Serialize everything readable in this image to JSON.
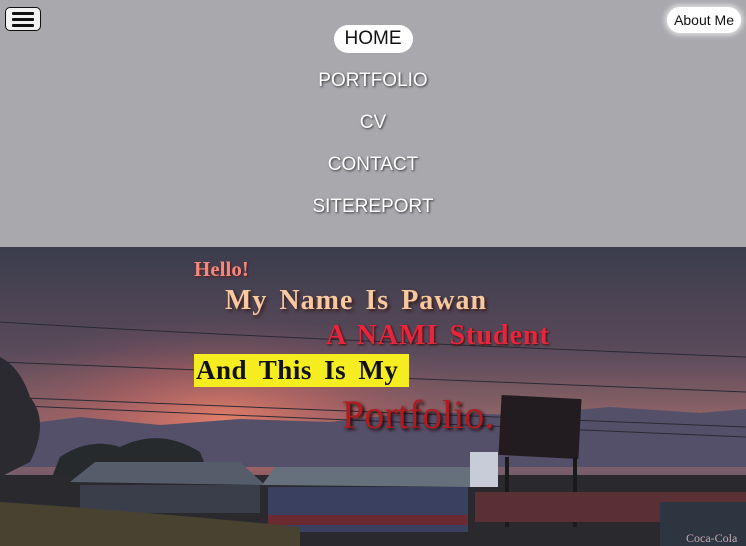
{
  "menu": {
    "icon": "hamburger-icon"
  },
  "about_button": "About Me",
  "nav": {
    "items": [
      {
        "label": "HOME",
        "active": true
      },
      {
        "label": "PORTFOLIO",
        "active": false
      },
      {
        "label": "CV",
        "active": false
      },
      {
        "label": "CONTACT",
        "active": false
      },
      {
        "label": "SITEREPORT",
        "active": false
      }
    ]
  },
  "hero": {
    "greeting": "Hello!",
    "name_line": "My Name Is Pawan",
    "role_line": "A NAMI Student",
    "intro_line": "And This Is My",
    "portfolio_word": "Portfolio.",
    "sign_text": "Coca-Cola"
  },
  "colors": {
    "topbar": "#a9a8ad",
    "highlight": "#f6ed20",
    "role": "#e8253c",
    "portfolio": "#b01c20"
  }
}
